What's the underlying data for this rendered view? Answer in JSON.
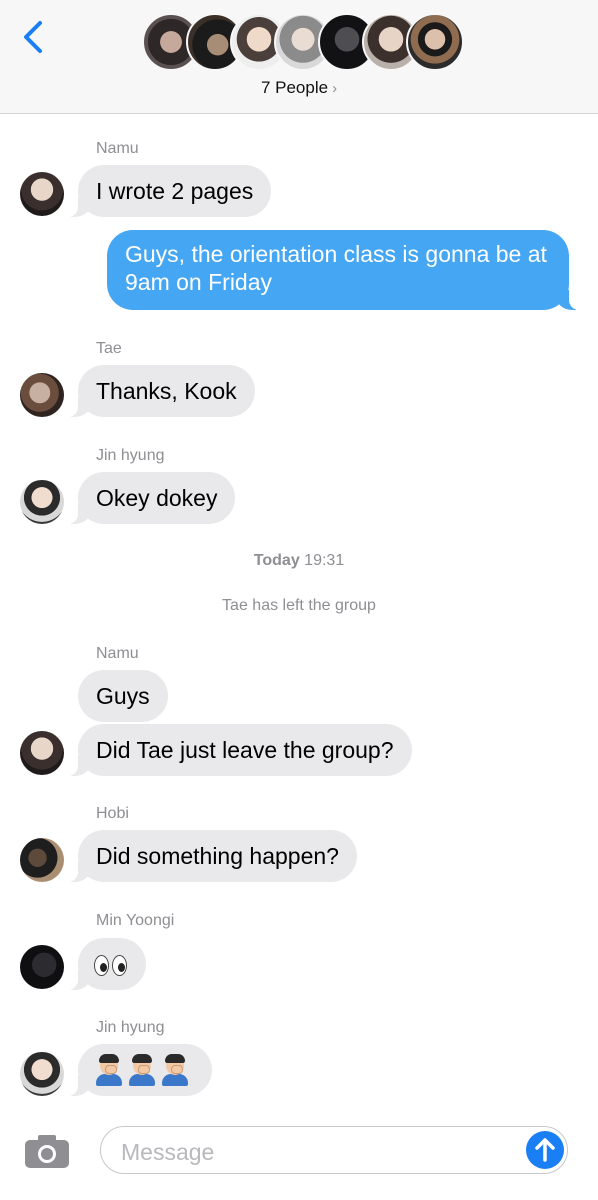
{
  "header": {
    "people_label": "7 People",
    "chevron": "›",
    "colors": {
      "back": "#1a7ef5"
    }
  },
  "conversation": {
    "msg1": {
      "sender": "Namu",
      "text": "I wrote 2 pages"
    },
    "outgoing": {
      "text": "Guys, the orientation class is gonna be at 9am on Friday",
      "color": "#45a6f3"
    },
    "msg2": {
      "sender": "Tae",
      "text": "Thanks, Kook"
    },
    "msg3": {
      "sender": "Jin hyung",
      "text": "Okey dokey"
    },
    "timestamp": {
      "day": "Today",
      "time": "19:31"
    },
    "system": "Tae has left the group",
    "msg4": {
      "sender": "Namu",
      "text1": "Guys",
      "text2": "Did Tae just leave the group?"
    },
    "msg5": {
      "sender": "Hobi",
      "text": "Did something happen?"
    },
    "msg6": {
      "sender": "Min Yoongi",
      "emoji": "eyes"
    },
    "msg7": {
      "sender": "Jin hyung",
      "emoji": "facepalm x3"
    }
  },
  "composer": {
    "placeholder": "Message",
    "camera_icon": "camera-icon",
    "send_icon": "arrow-up-icon"
  }
}
